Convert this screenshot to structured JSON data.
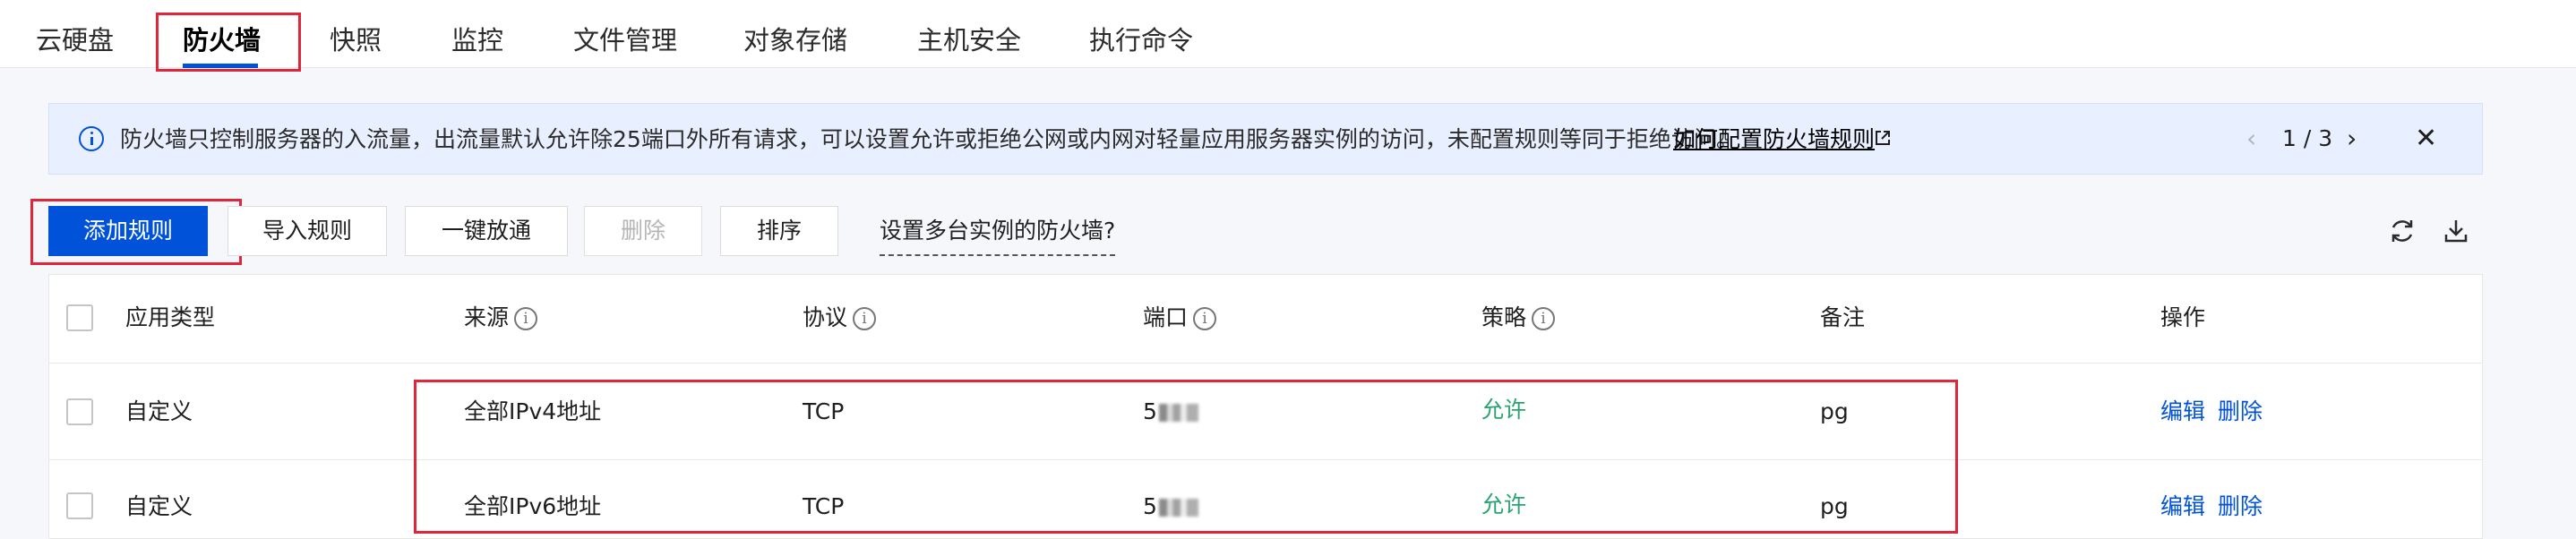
{
  "tabs": [
    "云硬盘",
    "防火墙",
    "快照",
    "监控",
    "文件管理",
    "对象存储",
    "主机安全",
    "执行命令"
  ],
  "notice": {
    "text": "防火墙只控制服务器的入流量，出流量默认允许除25端口外所有请求，可以设置允许或拒绝公网或内网对轻量应用服务器实例的访问，未配置规则等同于拒绝访问。",
    "link": "如何配置防火墙规则",
    "pager": "1 / 3"
  },
  "toolbar": {
    "add": "添加规则",
    "import": "导入规则",
    "one_click": "一键放通",
    "delete": "删除",
    "sort": "排序",
    "multi_instance_link": "设置多台实例的防火墙?"
  },
  "table": {
    "headers": {
      "type": "应用类型",
      "source": "来源",
      "protocol": "协议",
      "port": "端口",
      "policy": "策略",
      "remark": "备注",
      "actions": "操作"
    },
    "rows": [
      {
        "type": "自定义",
        "source": "全部IPv4地址",
        "protocol": "TCP",
        "port": "5",
        "policy": "允许",
        "remark": "pg",
        "edit": "编辑",
        "delete": "删除"
      },
      {
        "type": "自定义",
        "source": "全部IPv6地址",
        "protocol": "TCP",
        "port": "5",
        "policy": "允许",
        "remark": "pg",
        "edit": "编辑",
        "delete": "删除"
      }
    ]
  },
  "colors": {
    "primary": "#0052d9",
    "allow_green": "#2ba471",
    "highlight_red": "#e0263a",
    "notice_bg": "#e8efff"
  },
  "icons": [
    "info-icon",
    "external-link-icon",
    "chevron-left-icon",
    "chevron-right-icon",
    "close-icon",
    "refresh-icon",
    "download-icon",
    "help-circle-icon"
  ]
}
